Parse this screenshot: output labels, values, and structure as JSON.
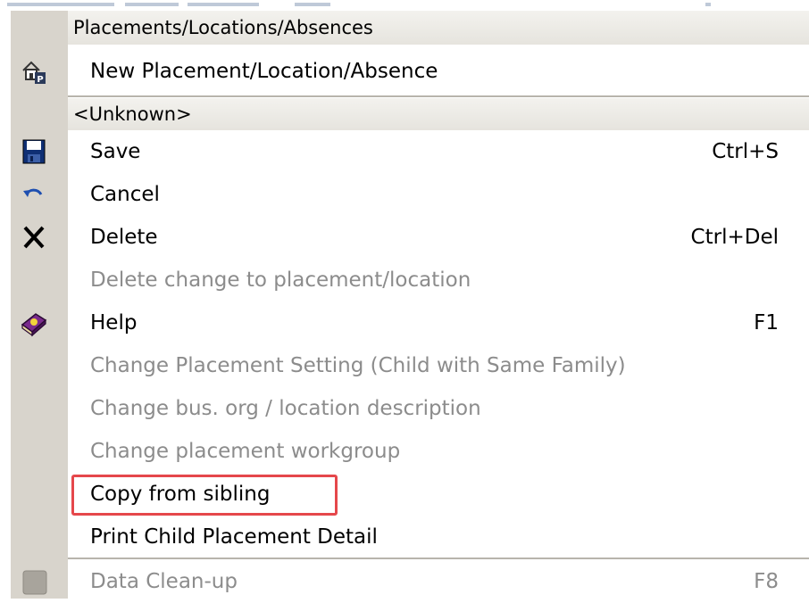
{
  "menu": {
    "section1_header": "Placements/Locations/Absences",
    "new_item": {
      "label": "New Placement/Location/Absence",
      "icon": "house-p-icon"
    },
    "section2_header": "<Unknown>",
    "items": [
      {
        "label": "Save",
        "shortcut": "Ctrl+S",
        "enabled": true,
        "icon": "floppy-disk-icon"
      },
      {
        "label": "Cancel",
        "shortcut": "",
        "enabled": true,
        "icon": "undo-icon"
      },
      {
        "label": "Delete",
        "shortcut": "Ctrl+Del",
        "enabled": true,
        "icon": "delete-x-icon"
      },
      {
        "label": "Delete change to placement/location",
        "shortcut": "",
        "enabled": false,
        "icon": ""
      },
      {
        "label": "Help",
        "shortcut": "F1",
        "enabled": true,
        "icon": "help-book-icon"
      },
      {
        "label": "Change Placement Setting (Child with Same Family)",
        "shortcut": "",
        "enabled": false,
        "icon": ""
      },
      {
        "label": "Change bus. org / location description",
        "shortcut": "",
        "enabled": false,
        "icon": ""
      },
      {
        "label": "Change placement workgroup",
        "shortcut": "",
        "enabled": false,
        "icon": ""
      },
      {
        "label": "Copy from sibling",
        "shortcut": "",
        "enabled": true,
        "icon": "",
        "highlighted": true
      },
      {
        "label": "Print Child Placement Detail",
        "shortcut": "",
        "enabled": true,
        "icon": ""
      },
      {
        "label": "Data Clean-up",
        "shortcut": "F8",
        "enabled": false,
        "icon": "gray-square-icon"
      }
    ]
  },
  "colors": {
    "highlight_border": "#e5474b",
    "disabled_text": "#8c8c8c",
    "icon_column": "#d8d4cc"
  }
}
